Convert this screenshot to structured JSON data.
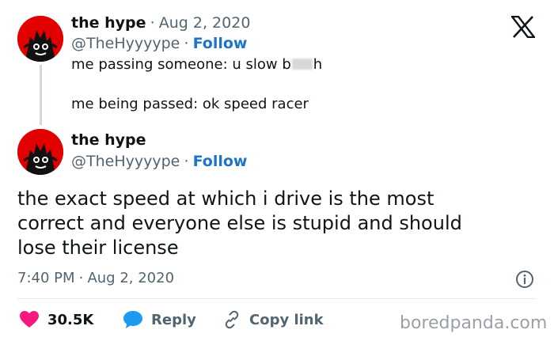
{
  "reply_tweet": {
    "display_name": "the hype",
    "separator": "·",
    "date": "Aug 2, 2020",
    "handle": "@TheHyyyype",
    "follow_label": "Follow",
    "line1_prefix": "me passing someone: u slow b",
    "line1_suffix": "h",
    "line2": "me being passed: ok speed racer"
  },
  "main_tweet": {
    "display_name": "the hype",
    "handle": "@TheHyyyype",
    "follow_label": "Follow",
    "text": "the exact speed at which i drive is the most correct and everyone else is stupid and should lose their license",
    "time": "7:40 PM",
    "date": "Aug 2, 2020"
  },
  "actions": {
    "like_count": "30.5K",
    "reply_label": "Reply",
    "copy_link_label": "Copy link"
  },
  "watermark": "boredpanda.com",
  "colors": {
    "avatar_bg": "#e30000",
    "follow": "#1d74c9",
    "like": "#f91880",
    "reply_bubble": "#1d9bf0"
  },
  "icons": [
    "x-logo-icon",
    "info-icon",
    "heart-icon",
    "reply-bubble-icon",
    "link-icon"
  ]
}
